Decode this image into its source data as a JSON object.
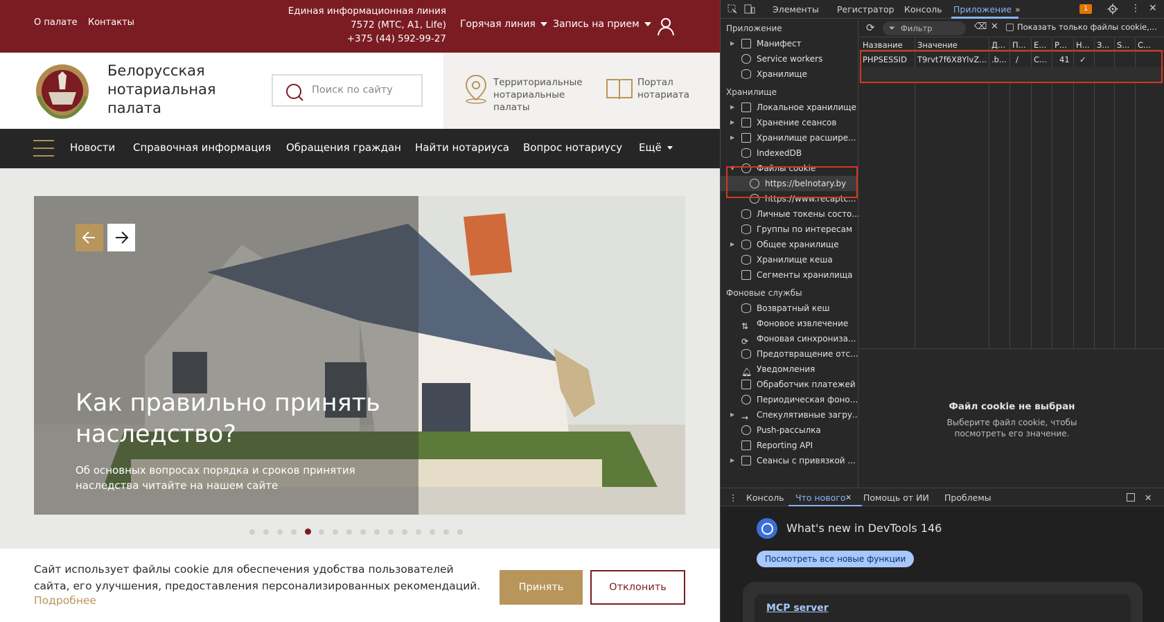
{
  "site": {
    "top": {
      "about": "О палате",
      "contacts": "Контакты",
      "info_line1": "Единая информационная линия",
      "info_line2": "7572 (МТС, A1, Life)",
      "info_line3": "+375 (44) 592-99-27",
      "hotline": "Горячая линия",
      "appointment": "Запись на прием"
    },
    "brand": {
      "name": "Белорусская нотариальная палата",
      "search_placeholder": "Поиск по сайту",
      "territorial": "Территориальные нотариальные палаты",
      "portal": "Портал нотариата"
    },
    "nav": [
      "Новости",
      "Справочная информация",
      "Обращения граждан",
      "Найти нотариуса",
      "Вопрос нотариусу",
      "Ещё"
    ],
    "hero": {
      "title": "Как правильно принять наследство?",
      "subtitle": "Об основных вопросах порядка и сроков принятия наследства читайте на нашем сайте",
      "slide_count": 16,
      "active_slide": 5
    },
    "cookie": {
      "text": "Сайт использует файлы cookie для обеспечения удобства пользователей сайта, его улучшения, предоставления персонализированных рекомендаций.",
      "more": "Подробнее",
      "accept": "Принять",
      "decline": "Отклонить"
    },
    "colors": {
      "brand": "#7b1c22",
      "gold": "#b8955a",
      "nav": "#262626"
    }
  },
  "devtools": {
    "tabs": [
      "Элементы",
      "Регистратор",
      "Консоль",
      "Приложение"
    ],
    "active_tab": "Приложение",
    "issues_count": "1",
    "sidebar": {
      "app_header": "Приложение",
      "app_items": [
        "Манифест",
        "Service workers",
        "Хранилище"
      ],
      "storage_header": "Хранилище",
      "storage_items": [
        "Локальное хранилище",
        "Хранение сеансов",
        "Хранилище расшире...",
        "IndexedDB",
        "Файлы cookie",
        "https://belnotary.by",
        "https://www.recaptc...",
        "Личные токены состо...",
        "Группы по интересам",
        "Общее хранилище",
        "Хранилище кеша",
        "Сегменты хранилища"
      ],
      "bg_header": "Фоновые службы",
      "bg_items": [
        "Возвратный кеш",
        "Фоновое извлечение",
        "Фоновая синхрониза...",
        "Предотвращение отс...",
        "Уведомления",
        "Обработчик платежей",
        "Периодическая фоно...",
        "Спекулятивные загру...",
        "Push-рассылка",
        "Reporting API",
        "Сеансы с привязкой ..."
      ]
    },
    "toolbar": {
      "filter_placeholder": "Фильтр",
      "only_cookies": "Показать только файлы cookie,..."
    },
    "table": {
      "headers": [
        "Название",
        "Значение",
        "Д...",
        "П...",
        "E...",
        "Р...",
        "Н...",
        "З...",
        "S...",
        "С..."
      ],
      "row": [
        "PHPSESSID",
        "T9rvt7f6X8YlvZ...",
        ".b...",
        "/",
        "С...",
        "41",
        "✓",
        "",
        "",
        ""
      ]
    },
    "detail": {
      "title": "Файл cookie не выбран",
      "text": "Выберите файл cookie, чтобы посмотреть его значение."
    },
    "drawer": {
      "tabs": [
        "Консоль",
        "Что нового",
        "Помощь от ИИ",
        "Проблемы"
      ],
      "active": "Что нового"
    },
    "whats_new": {
      "title": "What's new in DevTools 146",
      "button": "Посмотреть все новые функции",
      "card_link": "MCP server"
    }
  }
}
